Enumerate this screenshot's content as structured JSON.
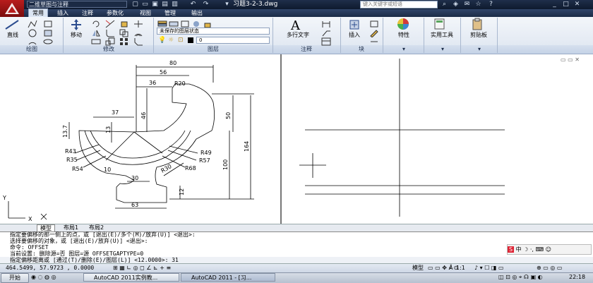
{
  "app": {
    "title": "习题3-2-3.dwg",
    "workspace": "二维草图与注释",
    "search_placeholder": "键入关键字或短语"
  },
  "menu_tabs": [
    "常用",
    "插入",
    "注释",
    "参数化",
    "视图",
    "管理",
    "输出"
  ],
  "ribbon": {
    "draw": {
      "big_label": "直线",
      "panel_label": "绘图"
    },
    "modify": {
      "big_label": "移动",
      "panel_label": "修改"
    },
    "layers": {
      "state_combo": "未保存的图层状态",
      "layer_combo": "0",
      "panel_label": "图层"
    },
    "annotation": {
      "big_label": "多行文字",
      "panel_label": "注释"
    },
    "block": {
      "big_label": "插入",
      "panel_label": "块"
    },
    "properties": {
      "big_label": "特性"
    },
    "utilities": {
      "big_label": "实用工具"
    },
    "clipboard": {
      "big_label": "剪贴板"
    }
  },
  "drawing": {
    "dimensions": [
      "80",
      "56",
      "36",
      "R20",
      "37",
      "46",
      "50",
      "13.7",
      "13",
      "164",
      "R43",
      "R35",
      "R54",
      "10",
      "R49",
      "R57",
      "R30",
      "R68",
      "100",
      "30",
      "12",
      "63"
    ],
    "ucs": {
      "x": "X",
      "y": "Y"
    }
  },
  "layout_tabs": [
    "模型",
    "布局1",
    "布局2"
  ],
  "command_lines": [
    "指定要偏移的那一侧上的点，或 [退出(E)/多个(M)/放弃(U)] <退出>:",
    "选择要偏移的对象，或 [退出(E)/放弃(U)] <退出>:",
    "命令: OFFSET",
    "当前设置: 删除源=否  图层=源  OFFSETGAPTYPE=0",
    "指定偏移距离或 [通过(T)/删除(E)/图层(L)] <12.0000>: 31"
  ],
  "status": {
    "coords": "464.5499, 57.9723 , 0.0000",
    "model": "模型",
    "scale": "1:1"
  },
  "taskbar": {
    "start": "开始",
    "tasks": [
      "AutoCAD 2011实例教...",
      "AutoCAD 2011 - [习..."
    ],
    "clock": "22:18"
  },
  "colors": {
    "accent": "#1b2b46",
    "dim": "#000000"
  }
}
